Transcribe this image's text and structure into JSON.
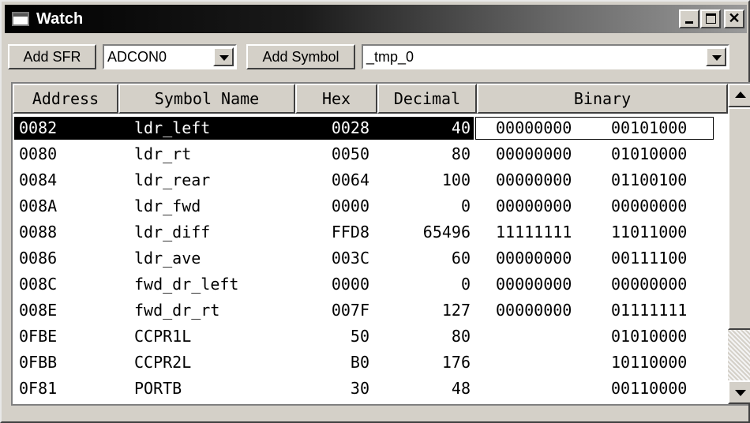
{
  "window": {
    "title": "Watch"
  },
  "toolbar": {
    "add_sfr_label": "Add SFR",
    "sfr_select_value": "ADCON0",
    "add_symbol_label": "Add Symbol",
    "symbol_select_value": "_tmp_0"
  },
  "columns": [
    "Address",
    "Symbol Name",
    "Hex",
    "Decimal",
    "Binary"
  ],
  "selected_row_index": 0,
  "rows": [
    {
      "address": "0082",
      "symbol": "ldr_left",
      "hex": "0028",
      "decimal": "40",
      "binary_hi": "00000000",
      "binary_lo": "00101000"
    },
    {
      "address": "0080",
      "symbol": "ldr_rt",
      "hex": "0050",
      "decimal": "80",
      "binary_hi": "00000000",
      "binary_lo": "01010000"
    },
    {
      "address": "0084",
      "symbol": "ldr_rear",
      "hex": "0064",
      "decimal": "100",
      "binary_hi": "00000000",
      "binary_lo": "01100100"
    },
    {
      "address": "008A",
      "symbol": "ldr_fwd",
      "hex": "0000",
      "decimal": "0",
      "binary_hi": "00000000",
      "binary_lo": "00000000"
    },
    {
      "address": "0088",
      "symbol": "ldr_diff",
      "hex": "FFD8",
      "decimal": "65496",
      "binary_hi": "11111111",
      "binary_lo": "11011000"
    },
    {
      "address": "0086",
      "symbol": "ldr_ave",
      "hex": "003C",
      "decimal": "60",
      "binary_hi": "00000000",
      "binary_lo": "00111100"
    },
    {
      "address": "008C",
      "symbol": "fwd_dr_left",
      "hex": "0000",
      "decimal": "0",
      "binary_hi": "00000000",
      "binary_lo": "00000000"
    },
    {
      "address": "008E",
      "symbol": "fwd_dr_rt",
      "hex": "007F",
      "decimal": "127",
      "binary_hi": "00000000",
      "binary_lo": "01111111"
    },
    {
      "address": "0FBE",
      "symbol": "CCPR1L",
      "hex": "50",
      "decimal": "80",
      "binary_hi": "",
      "binary_lo": "01010000"
    },
    {
      "address": "0FBB",
      "symbol": "CCPR2L",
      "hex": "B0",
      "decimal": "176",
      "binary_hi": "",
      "binary_lo": "10110000"
    },
    {
      "address": "0F81",
      "symbol": "PORTB",
      "hex": "30",
      "decimal": "48",
      "binary_hi": "",
      "binary_lo": "00110000"
    }
  ]
}
